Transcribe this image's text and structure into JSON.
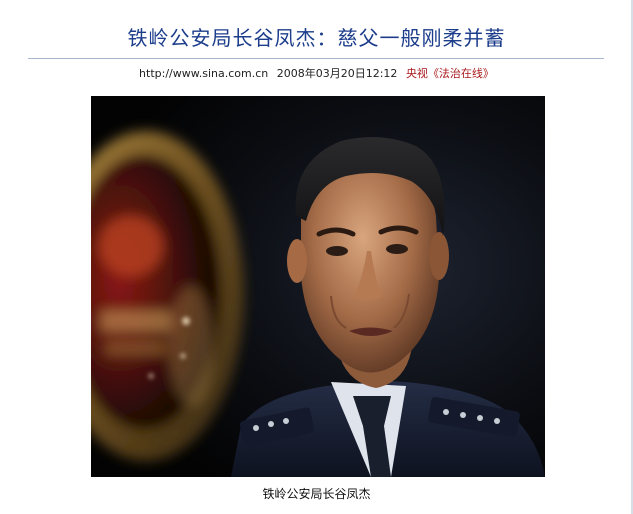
{
  "article": {
    "headline": "铁岭公安局长谷凤杰：慈父一般刚柔并蓄",
    "meta": {
      "url": "http://www.sina.com.cn",
      "date": "2008年03月20日12:12",
      "source_prefix": "央视",
      "source_link": "《法治在线》"
    },
    "photo_caption": "铁岭公安局长谷凤杰"
  },
  "colors": {
    "headline": "#1c3d8b",
    "source": "#a8191c",
    "rule": "#a6b6cf"
  }
}
